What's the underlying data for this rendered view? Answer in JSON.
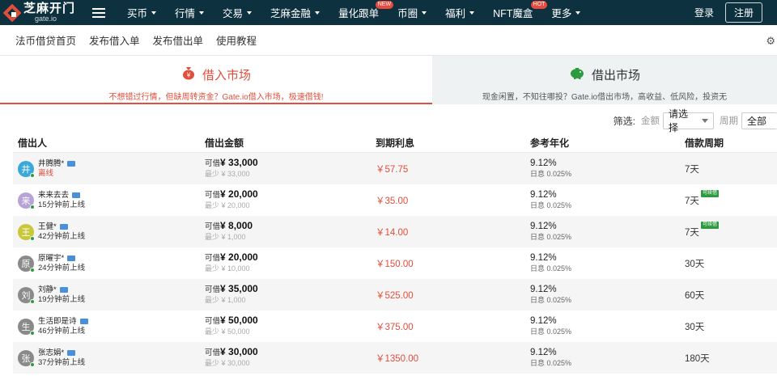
{
  "brand": {
    "name_cn": "芝麻开门",
    "name_en": "gate.io",
    "colors": {
      "nav_bg": "#0e3140",
      "accent": "#e04e3c",
      "online": "#2e9a3f"
    }
  },
  "topnav": {
    "items": [
      {
        "label": "买币",
        "caret": true
      },
      {
        "label": "行情",
        "caret": true
      },
      {
        "label": "交易",
        "caret": true
      },
      {
        "label": "芝麻金融",
        "caret": true
      },
      {
        "label": "量化跟单",
        "caret": false,
        "badge": "NEW"
      },
      {
        "label": "币圈",
        "caret": true
      },
      {
        "label": "福利",
        "caret": true
      },
      {
        "label": "NFT魔盒",
        "caret": false,
        "badge": "HOT"
      },
      {
        "label": "更多",
        "caret": true
      }
    ],
    "login": "登录",
    "register": "注册"
  },
  "subnav": {
    "items": [
      "法币借贷首页",
      "发布借入单",
      "发布借出单",
      "使用教程"
    ],
    "settings_icon": "gear-icon"
  },
  "markets": {
    "borrow": {
      "title": "借入市场",
      "subtitle": "不想错过行情，但缺周转资金？Gate.io借入市场，极速借钱!"
    },
    "lend": {
      "title": "借出市场",
      "subtitle": "现金闲置，不知往哪投？Gate.io借出市场，高收益、低风险，投资无"
    }
  },
  "filter": {
    "label": "筛选:",
    "amount_label": "金额",
    "amount_value": "请选择",
    "period_label": "周期",
    "period_value": "全部"
  },
  "table": {
    "headers": [
      "借出人",
      "借出金额",
      "到期利息",
      "参考年化",
      "借款周期"
    ],
    "avail_prefix": "可借",
    "min_prefix": "最少",
    "daily_prefix": "日息",
    "renew_badge": "可续借",
    "rows": [
      {
        "avatar": "井",
        "avatar_color": "#3aa8d8",
        "name": "井腾腾*",
        "status": "离线",
        "offline": true,
        "amount": "¥ 33,000",
        "min": "¥ 33,000",
        "interest": "￥57.75",
        "apr": "9.12%",
        "daily": "0.025%",
        "period": "7天",
        "renew": false
      },
      {
        "avatar": "来",
        "avatar_color": "#b9a3d6",
        "name": "来来去去",
        "status": "15分钟前上线",
        "offline": false,
        "amount": "¥ 20,000",
        "min": "¥ 20,000",
        "interest": "￥35.00",
        "apr": "9.12%",
        "daily": "0.025%",
        "period": "7天",
        "renew": true
      },
      {
        "avatar": "王",
        "avatar_color": "#c8c83a",
        "name": "王健*",
        "status": "42分钟前上线",
        "offline": false,
        "amount": "¥ 8,000",
        "min": "¥ 1,000",
        "interest": "￥14.00",
        "apr": "9.12%",
        "daily": "0.025%",
        "period": "7天",
        "renew": true
      },
      {
        "avatar": "原",
        "avatar_color": "#8a8a8a",
        "name": "原曜宇*",
        "status": "24分钟前上线",
        "offline": false,
        "amount": "¥ 20,000",
        "min": "¥ 10,000",
        "interest": "￥150.00",
        "apr": "9.12%",
        "daily": "0.025%",
        "period": "30天",
        "renew": false
      },
      {
        "avatar": "刘",
        "avatar_color": "#8a8a8a",
        "name": "刘静*",
        "status": "19分钟前上线",
        "offline": false,
        "amount": "¥ 35,000",
        "min": "¥ 1,000",
        "interest": "￥525.00",
        "apr": "9.12%",
        "daily": "0.025%",
        "period": "60天",
        "renew": false
      },
      {
        "avatar": "生",
        "avatar_color": "#8a8a8a",
        "name": "生活即是诗",
        "status": "46分钟前上线",
        "offline": false,
        "amount": "¥ 50,000",
        "min": "¥ 50,000",
        "interest": "￥375.00",
        "apr": "9.12%",
        "daily": "0.025%",
        "period": "30天",
        "renew": false
      },
      {
        "avatar": "张",
        "avatar_color": "#8a8a8a",
        "name": "张志娟*",
        "status": "37分钟前上线",
        "offline": false,
        "amount": "¥ 30,000",
        "min": "¥ 30,000",
        "interest": "￥1350.00",
        "apr": "9.12%",
        "daily": "0.025%",
        "period": "180天",
        "renew": false
      }
    ]
  }
}
